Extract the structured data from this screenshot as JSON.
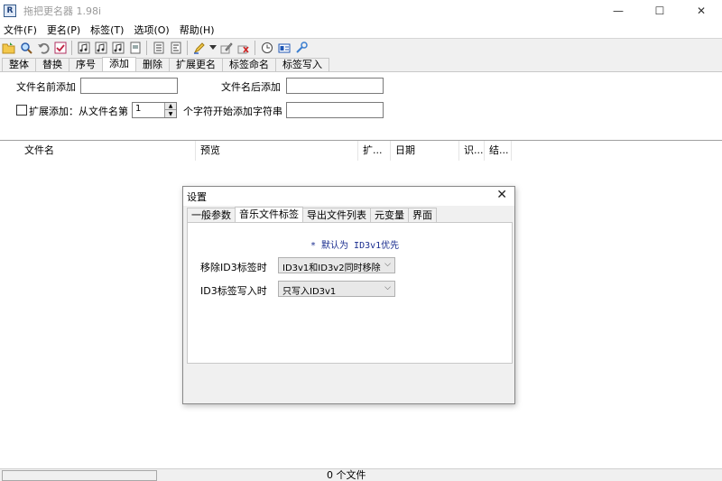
{
  "window": {
    "title": "拖把更名器 1.98i",
    "app_icon_text": "R",
    "minimize": "—",
    "maximize": "☐",
    "close": "✕"
  },
  "menu": [
    "文件(F)",
    "更名(P)",
    "标签(T)",
    "选项(O)",
    "帮助(H)"
  ],
  "toolbar": {
    "icons": [
      "open-folder-icon",
      "search-icon",
      "undo-icon",
      "check-icon",
      "music-note-icon",
      "music-note-icon",
      "music-note-icon",
      "document-icon",
      "list-icon",
      "list-icon",
      "highlighter-icon",
      "dropdown-arrow-icon",
      "edit-icon",
      "delete-icon",
      "clock-icon",
      "id-card-icon",
      "tools-icon"
    ]
  },
  "main_tabs": [
    "整体",
    "替换",
    "序号",
    "添加",
    "删除",
    "扩展更名",
    "标签命名",
    "标签写入"
  ],
  "active_tab": "添加",
  "add_panel": {
    "prefix_label": "文件名前添加",
    "prefix_value": "",
    "suffix_label": "文件名后添加",
    "suffix_value": "",
    "extend_checkbox_label": "扩展添加：从文件名第",
    "extend_checked": false,
    "position_value": "1",
    "insert_label": "个字符开始添加字符串",
    "insert_value": ""
  },
  "list": {
    "columns": [
      "文件名",
      "预览",
      "扩...",
      "日期",
      "识...",
      "结..."
    ]
  },
  "status": {
    "file_count": "0 个文件"
  },
  "dialog": {
    "title": "设置",
    "close": "✕",
    "tabs": [
      "一般参数",
      "音乐文件标签",
      "导出文件列表",
      "元变量",
      "界面"
    ],
    "active_tab": "音乐文件标签",
    "note": "* 默认为 ID3v1优先",
    "remove_label": "移除ID3标签时",
    "remove_value": "ID3v1和ID3v2同时移除",
    "write_label": "ID3标签写入时",
    "write_value": "只写入ID3v1"
  }
}
